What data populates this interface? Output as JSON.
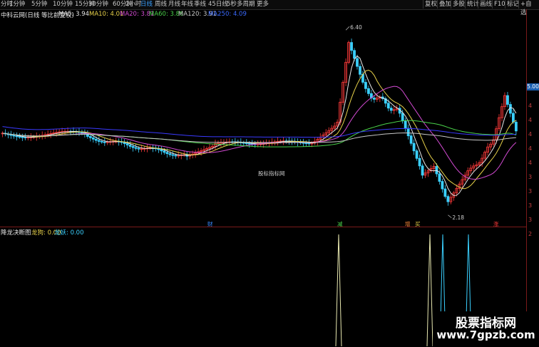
{
  "toolbar": {
    "periods": [
      "分时",
      "1分钟",
      "5分钟",
      "10分钟",
      "15分钟",
      "30分钟",
      "60分钟",
      "2小时",
      "日线",
      "周线",
      "月线",
      "年线",
      "季线",
      "45日线",
      "5秒",
      "多周期",
      "更多"
    ],
    "active_period": "日线",
    "right_buttons": [
      "复权",
      "叠加",
      "多股",
      "统计",
      "画线",
      "F10",
      "标记",
      "+自选"
    ]
  },
  "chart_legend": {
    "stock": "中科云网(日线 等比前复权)",
    "ma5": "MA5: 3.94",
    "ma10": "MA10: 4.01",
    "ma20": "MA20: 3.81",
    "ma60": "MA60: 3.86",
    "ma120": "MA120: 3.91",
    "ma250": "MA250: 4.09"
  },
  "colors": {
    "up": "#ff3a3a",
    "down": "#3ad0ff",
    "ma5": "#e8e8e8",
    "ma10": "#e8d24a",
    "ma20": "#d24ad2",
    "ma60": "#4ad24a",
    "ma120": "#c8c8c8",
    "ma250": "#3a3aff"
  },
  "annotations": {
    "high": "6.40",
    "low": "2.18",
    "price_tag": "5.00",
    "center_watermark": "股标指标网"
  },
  "signals": [
    "财",
    "减",
    "增",
    "买",
    "涨"
  ],
  "axis": {
    "ticks": [
      "5",
      "4",
      "4",
      "4",
      "4",
      "4",
      "3",
      "3",
      "3",
      "3",
      "2"
    ]
  },
  "sub_indicator": {
    "name": "降龙决断图",
    "v1": "龙狗: 0.00",
    "v2": "龙妖: 0.00"
  },
  "brand": {
    "line1": "股票指标网",
    "line2": "www.7gpzb.com"
  }
}
